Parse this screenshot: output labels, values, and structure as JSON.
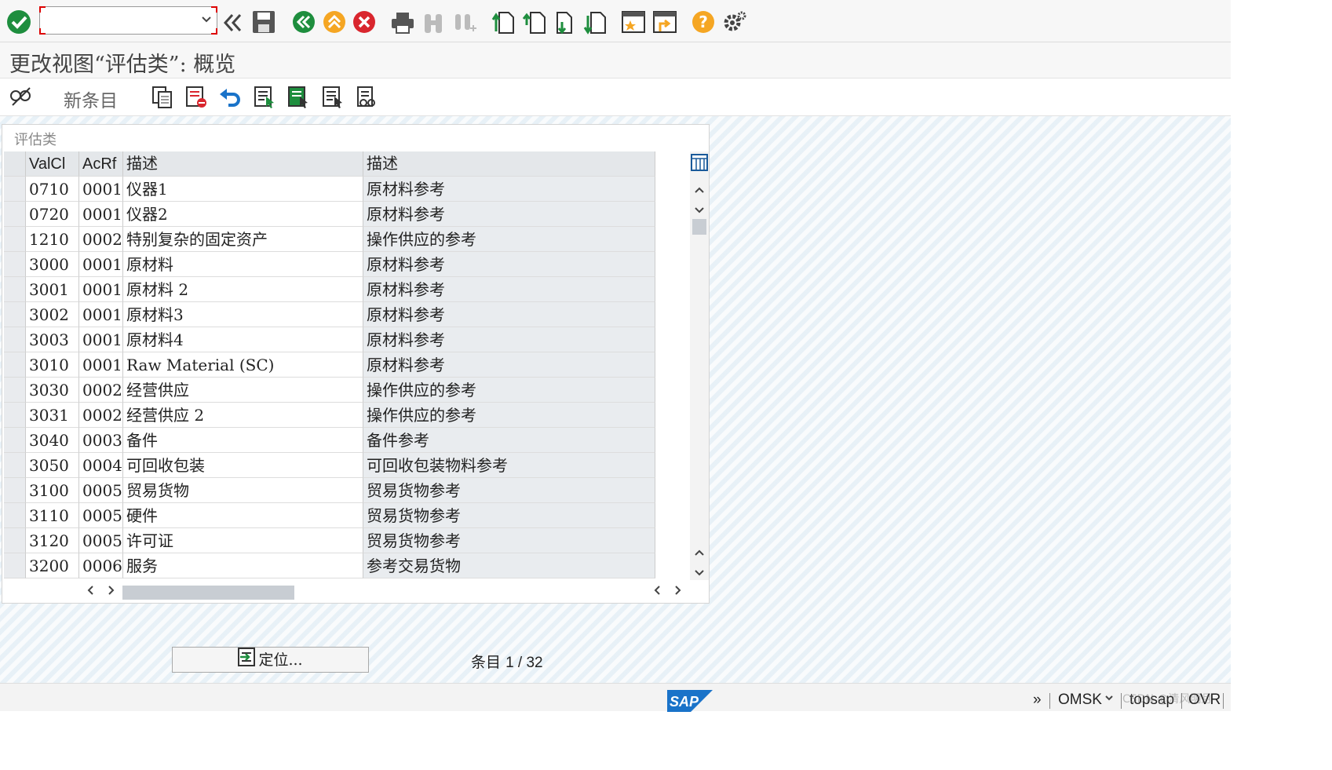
{
  "window_title": "更改视图“评估类”: 概览",
  "toolbar": {
    "command_field_value": "",
    "icons": [
      "enter-icon",
      "command-field",
      "back-double-icon",
      "save-icon",
      "back-icon",
      "exit-icon",
      "cancel-icon",
      "print-icon",
      "find-icon",
      "find-next-icon",
      "first-page-icon",
      "previous-page-icon",
      "next-page-icon",
      "last-page-icon",
      "new-session-icon",
      "shortcut-icon",
      "help-icon",
      "settings-icon"
    ]
  },
  "app_toolbar": {
    "new_entries_label": "新条目",
    "icons": [
      "display-change-icon",
      "copy-as-icon",
      "delete-icon",
      "undo-icon",
      "select-all-icon",
      "select-block-icon",
      "deselect-all-icon",
      "print-field-names-icon"
    ]
  },
  "table": {
    "title": "评估类",
    "columns": [
      "ValCl",
      "AcRf",
      "描述",
      "描述"
    ],
    "rows": [
      [
        "0710",
        "0001",
        "仪器1",
        "原材料参考"
      ],
      [
        "0720",
        "0001",
        "仪器2",
        "原材料参考"
      ],
      [
        "1210",
        "0002",
        "特别复杂的固定资产",
        "操作供应的参考"
      ],
      [
        "3000",
        "0001",
        "原材料",
        "原材料参考"
      ],
      [
        "3001",
        "0001",
        "原材料 2",
        "原材料参考"
      ],
      [
        "3002",
        "0001",
        "原材料3",
        "原材料参考"
      ],
      [
        "3003",
        "0001",
        "原材料4",
        "原材料参考"
      ],
      [
        "3010",
        "0001",
        "Raw Material (SC)",
        "原材料参考"
      ],
      [
        "3030",
        "0002",
        "经营供应",
        "操作供应的参考"
      ],
      [
        "3031",
        "0002",
        "经营供应 2",
        "操作供应的参考"
      ],
      [
        "3040",
        "0003",
        "备件",
        "备件参考"
      ],
      [
        "3050",
        "0004",
        "可回收包装",
        "可回收包装物料参考"
      ],
      [
        "3100",
        "0005",
        "贸易货物",
        "贸易货物参考"
      ],
      [
        "3110",
        "0005",
        "硬件",
        "贸易货物参考"
      ],
      [
        "3120",
        "0005",
        "许可证",
        "贸易货物参考"
      ],
      [
        "3200",
        "0006",
        "服务",
        "参考交易货物"
      ]
    ]
  },
  "position_button": "定位...",
  "entries_label": "条目",
  "entries_value": "1 / 32",
  "status_bar": {
    "expand": "»",
    "system": "OMSK",
    "server": "topsap",
    "mode": "OVR",
    "logo": "SAP",
    "watermark": "CSDN @清风明月"
  },
  "colors": {
    "accent_green": "#1e8e3e",
    "accent_orange": "#f5a623",
    "accent_red": "#d9262e",
    "sap_blue": "#1a73c9"
  }
}
